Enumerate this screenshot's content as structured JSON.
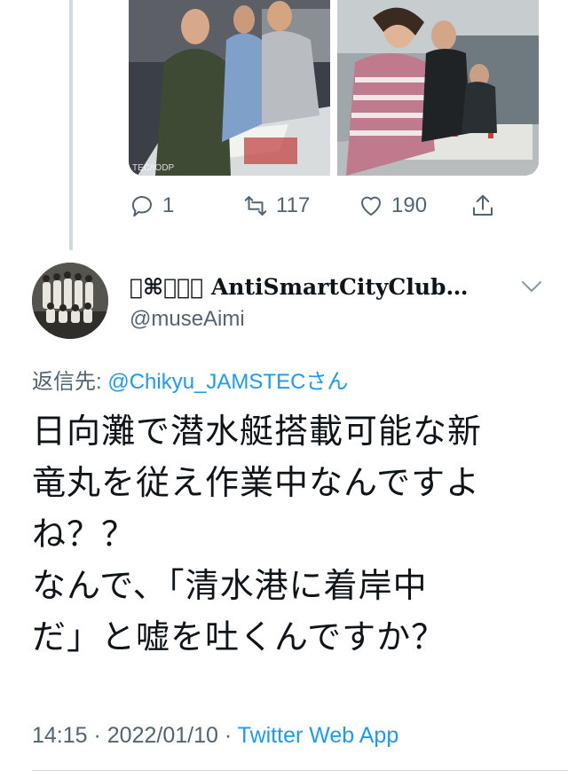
{
  "previous_tweet": {
    "media": [
      {
        "icon": "photo-lab-people-drawing-maps"
      },
      {
        "icon": "photo-lab-people-model-table"
      }
    ],
    "media_watermark": "TEC/IODP",
    "actions": {
      "reply_count": "1",
      "retweet_count": "117",
      "like_count": "190"
    }
  },
  "tweet": {
    "display_name": "⌘☯⚘♞ AntiSmartCityClub…",
    "handle": "@museAimi",
    "replying_to_label": "返信先:",
    "replying_to_mention": "@Chikyu_JAMSTEC",
    "replying_to_suffix": "さん",
    "body_lines": [
      "日向灘で潜水艇搭載可能な新",
      "竜丸を従え作業中なんですよ",
      "ね？？",
      "なんで、「清水港に着岸中",
      "だ」と嘘を吐くんですか？"
    ],
    "timestamp": "14:15 · 2022/01/10 · ",
    "source_app": "Twitter Web App"
  },
  "colors": {
    "accent": "#1d9bf0",
    "muted": "#536471",
    "text": "#0f1419",
    "rule": "#cfd9de"
  }
}
